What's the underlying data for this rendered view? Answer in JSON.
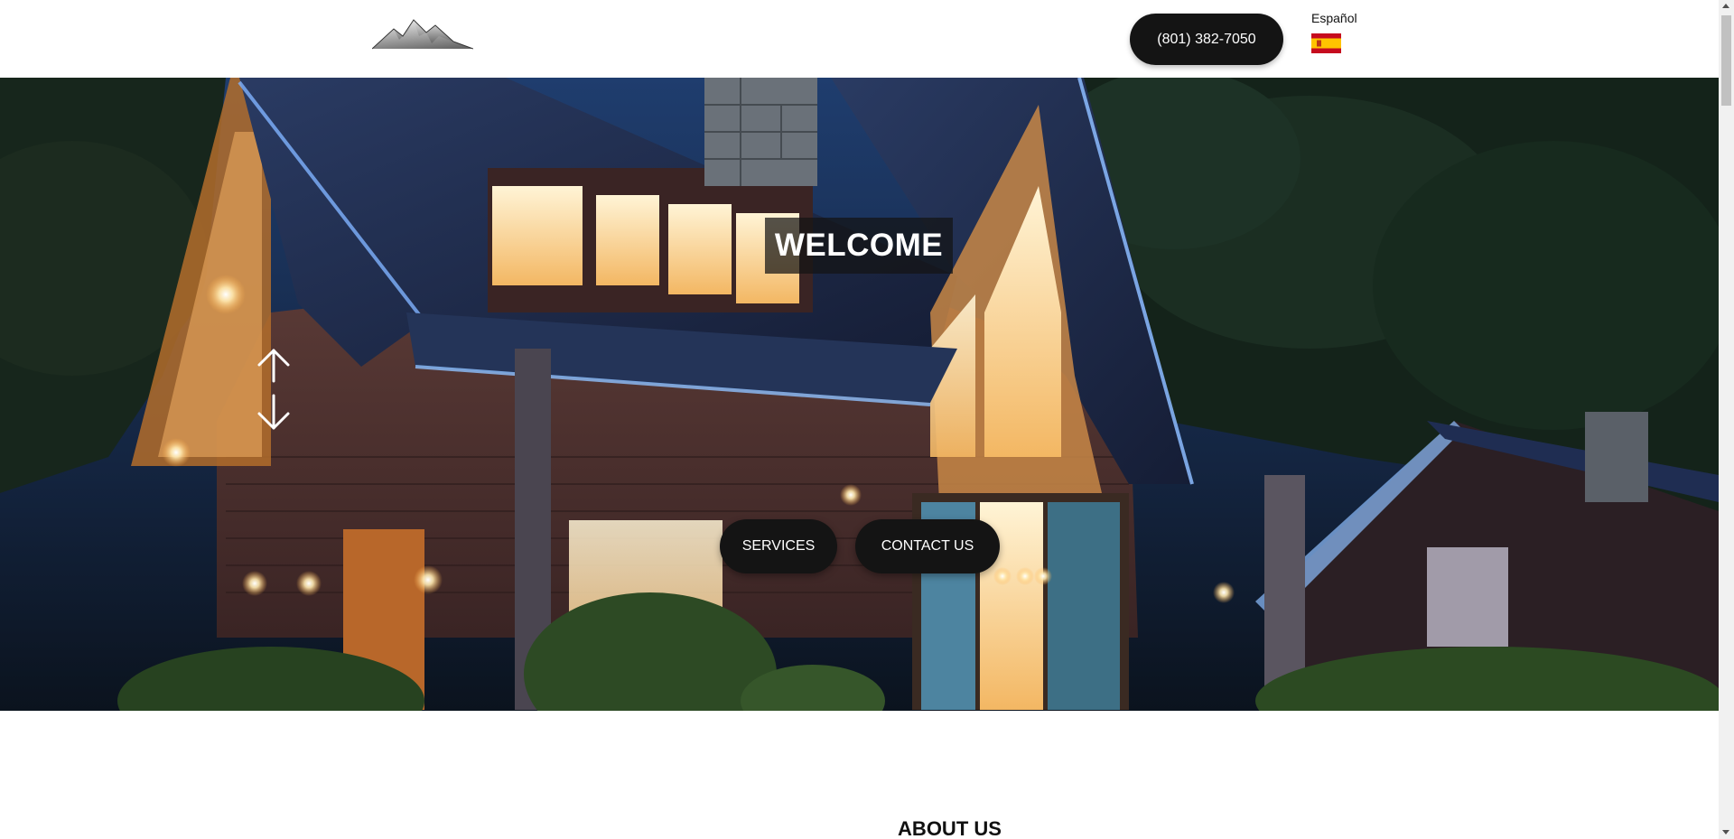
{
  "header": {
    "logo_icon": "mountain-logo-icon",
    "phone_label": "(801) 382-7050",
    "language_label": "Español",
    "flag_icon": "spain-flag-icon"
  },
  "hero": {
    "welcome_text": "WELCOME",
    "arrows_icon": "up-down-arrows-icon",
    "services_label": "SERVICES",
    "contact_label": "CONTACT US"
  },
  "about": {
    "title": "ABOUT US"
  },
  "colors": {
    "button_bg": "#141414",
    "button_text": "#ffffff",
    "flag_red": "#c60b1e",
    "flag_yellow": "#ffc400"
  }
}
